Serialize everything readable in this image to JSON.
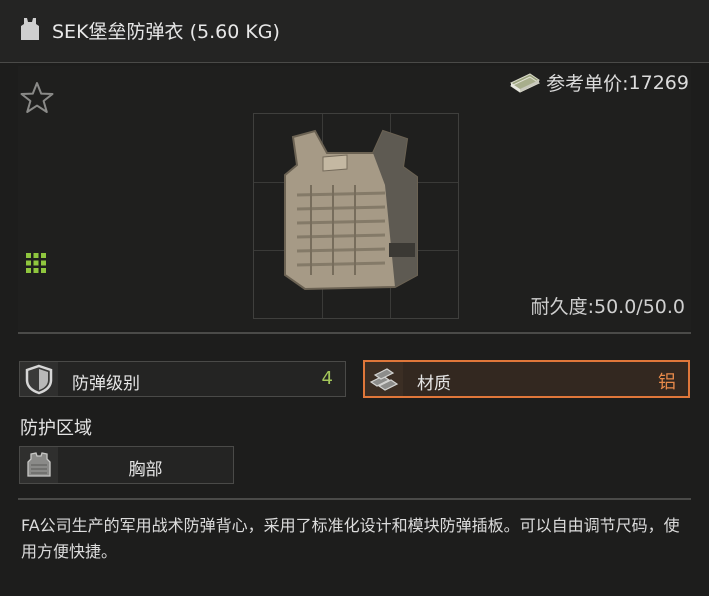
{
  "header": {
    "title": "SEK堡垒防弹衣 (5.60 KG)",
    "icon": "vest-icon"
  },
  "price": {
    "label": "参考单价:",
    "value": "17269",
    "icon": "money-icon"
  },
  "favorite": {
    "icon": "star-icon"
  },
  "durability": {
    "label": "耐久度:",
    "value": "50.0/50.0"
  },
  "stats": {
    "armor_class": {
      "label": "防弹级别",
      "value": "4",
      "value_color": "#a3c65a",
      "icon": "shield-icon"
    },
    "material": {
      "label": "材质",
      "value": "铝",
      "value_color": "#e88a4a",
      "accent": "#e0773a",
      "icon": "metal-ingots-icon"
    }
  },
  "protection": {
    "title": "防护区域",
    "zones": [
      {
        "label": "胸部",
        "icon": "chest-armor-icon"
      }
    ]
  },
  "description": "FA公司生产的军用战术防弹背心，采用了标准化设计和模块防弹插板。可以自由调节尺码，使用方便快捷。",
  "colors": {
    "background": "#1d1d1c",
    "grid_icon": "#8fc63e",
    "divider": "#4a4a48"
  }
}
